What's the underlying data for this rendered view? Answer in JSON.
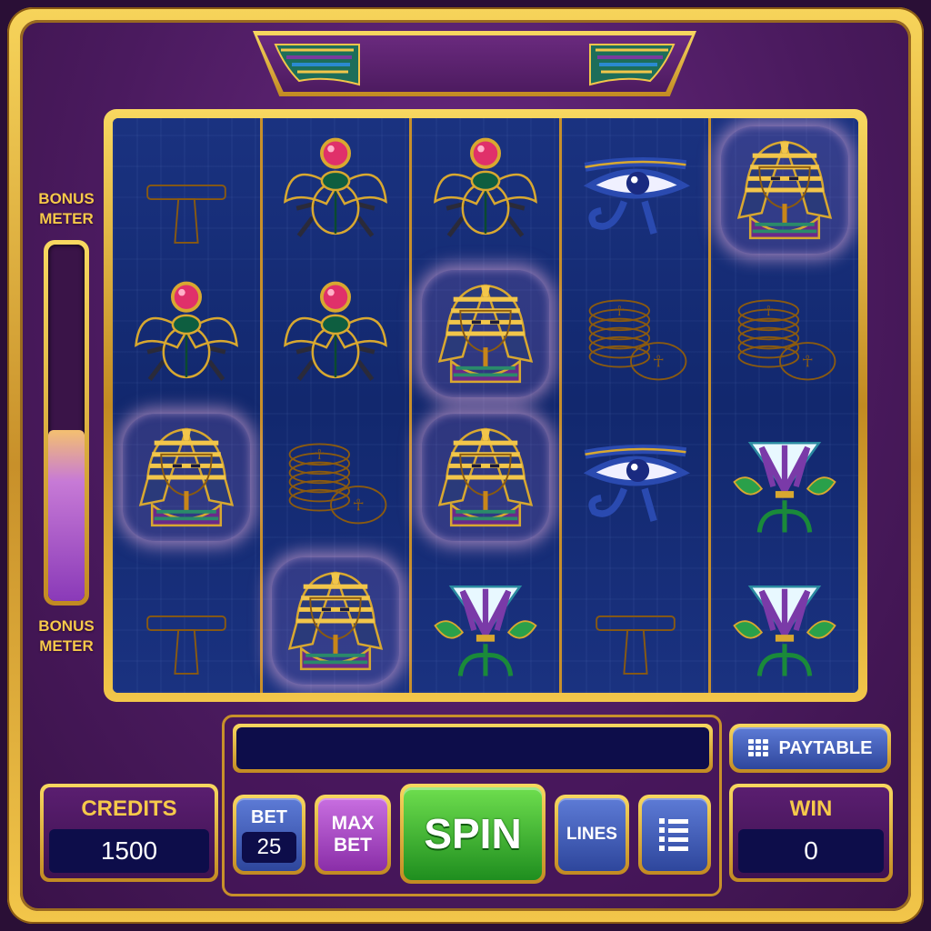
{
  "bonus_meter": {
    "label_top": "BONUS\nMETER",
    "label_bottom": "BONUS\nMETER",
    "fill_fraction": 0.48
  },
  "reels": [
    [
      "ankh",
      "scarab",
      "pharaoh",
      "ankh"
    ],
    [
      "scarab",
      "scarab",
      "gold-coins",
      "pharaoh"
    ],
    [
      "scarab",
      "pharaoh",
      "pharaoh",
      "lotus"
    ],
    [
      "eye-of-horus",
      "gold-coins",
      "eye-of-horus",
      "ankh"
    ],
    [
      "pharaoh",
      "gold-coins",
      "lotus",
      "lotus"
    ]
  ],
  "highlighted": [
    [
      0,
      2
    ],
    [
      1,
      3
    ],
    [
      2,
      1
    ],
    [
      2,
      2
    ],
    [
      4,
      0
    ]
  ],
  "credits": {
    "title": "CREDITS",
    "value": "1500"
  },
  "win": {
    "title": "WIN",
    "value": "0"
  },
  "buttons": {
    "bet_label": "BET",
    "bet_value": "25",
    "max_bet_label": "MAX\nBET",
    "spin_label": "SPIN",
    "lines_label": "LINES",
    "paytable_label": "PAYTABLE",
    "menu_icon": "list-icon"
  },
  "message": "",
  "colors": {
    "gold": "#f2c64a",
    "purple_bg": "#4a1a5e",
    "reel_blue": "#12286e",
    "spin_green": "#2fae2f"
  }
}
